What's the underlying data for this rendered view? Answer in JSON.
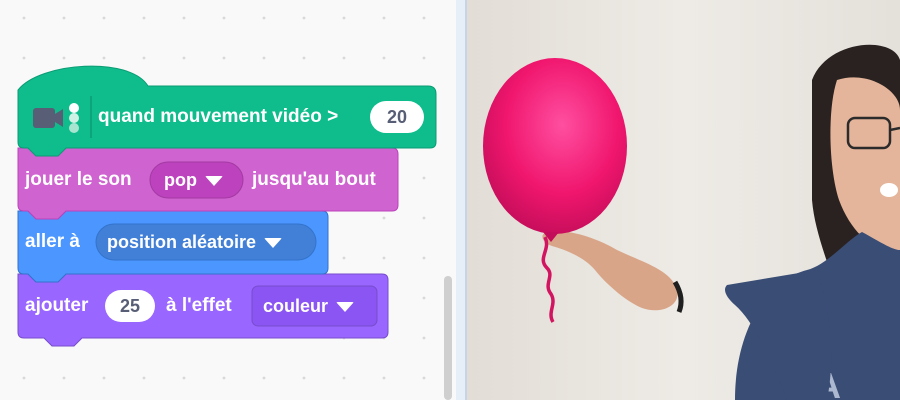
{
  "workspace": {
    "blocks": {
      "hat": {
        "label": "quand mouvement vidéo >",
        "threshold": "20",
        "icon": "video-camera-icon",
        "color": "#0fbd8c"
      },
      "sound": {
        "label_before": "jouer le son",
        "dropdown": "pop",
        "label_after": "jusqu'au bout",
        "color": "#cf63cf"
      },
      "motion": {
        "label": "aller à",
        "dropdown": "position aléatoire",
        "color": "#4c97ff"
      },
      "looks": {
        "label_before": "ajouter",
        "value": "25",
        "label_after": "à l'effet",
        "dropdown": "couleur",
        "color": "#9966ff"
      }
    }
  },
  "stage": {
    "balloon_color": "#f0166e"
  }
}
